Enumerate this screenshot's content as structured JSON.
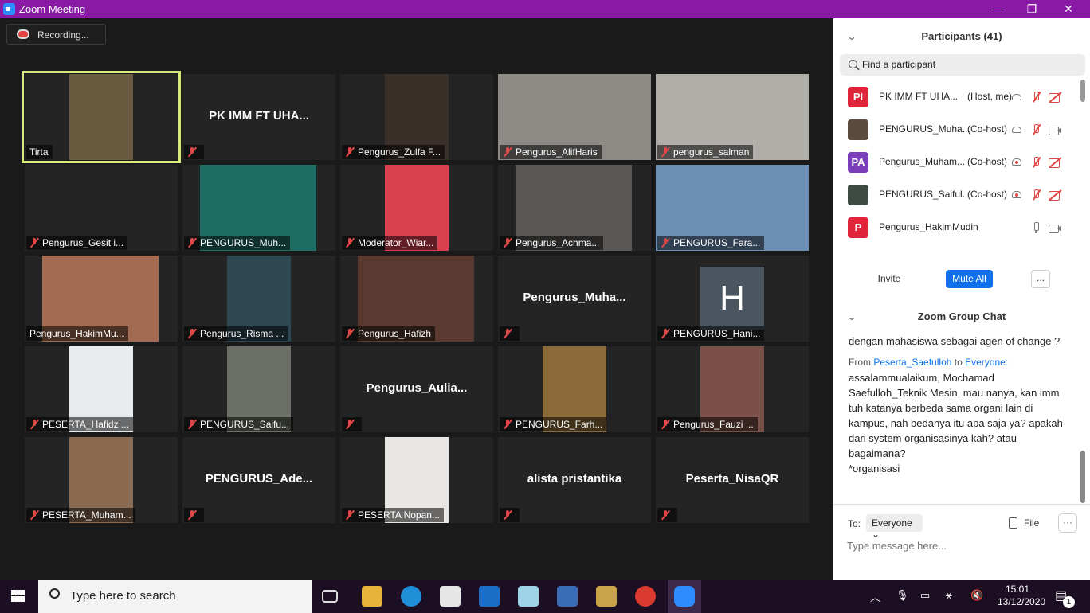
{
  "window": {
    "title": "Zoom Meeting",
    "minimize": "—",
    "restore": "❐",
    "close": "✕"
  },
  "recording": {
    "label": "Recording..."
  },
  "tiles": [
    {
      "label": "Tirta",
      "muted": false,
      "active": true,
      "video": "#6a5a40"
    },
    {
      "big": "PK IMM FT UHA...",
      "label": "",
      "muted": true
    },
    {
      "label": "Pengurus_Zulfa F...",
      "muted": true,
      "video": "#3b2f2a"
    },
    {
      "label": "Pengurus_AlifHaris",
      "muted": true,
      "video": "#8d8a86"
    },
    {
      "label": "pengurus_salman",
      "muted": true,
      "video": "#b0aea8"
    },
    {
      "label": "Pengurus_Gesit i...",
      "muted": true
    },
    {
      "label": "PENGURUS_Muh...",
      "muted": true,
      "video": "#1f6e64"
    },
    {
      "label": "Moderator_Wiar...",
      "muted": true,
      "video": "#d94050"
    },
    {
      "label": "Pengurus_Achma...",
      "muted": true,
      "video": "#5a5854"
    },
    {
      "label": "PENGURUS_Fara...",
      "muted": true,
      "video": "#6d8fb5"
    },
    {
      "label": "Pengurus_HakimMu...",
      "muted": false,
      "video": "#a36b52"
    },
    {
      "label": "Pengurus_Risma ...",
      "muted": true,
      "video": "#2d4850"
    },
    {
      "label": "Pengurus_Hafizh",
      "muted": true,
      "video": "#5a3a30"
    },
    {
      "big": "Pengurus_Muha...",
      "label": "",
      "muted": true
    },
    {
      "avatar": "H",
      "label": "PENGURUS_Hani...",
      "muted": true
    },
    {
      "label": "PESERTA_Hafidz ...",
      "muted": true,
      "video": "#e8ecee"
    },
    {
      "label": "PENGURUS_Saifu...",
      "muted": true,
      "video": "#6b6f66"
    },
    {
      "big": "Pengurus_Aulia...",
      "label": "",
      "muted": true
    },
    {
      "label": "PENGURUS_Farh...",
      "muted": true,
      "video": "#8a6a38"
    },
    {
      "label": "Pengurus_Fauzi ...",
      "muted": true,
      "video": "#7a5048"
    },
    {
      "label": "PESERTA_Muham...",
      "muted": true,
      "video": "#8a6a50"
    },
    {
      "big": "PENGURUS_Ade...",
      "label": "",
      "muted": true
    },
    {
      "label": "PESERTA Nopan...",
      "muted": true,
      "video": "#e9e7e3"
    },
    {
      "big": "alista pristantika",
      "label": "",
      "muted": true
    },
    {
      "big": "Peserta_NisaQR",
      "label": "",
      "muted": true
    }
  ],
  "participants": {
    "title": "Participants (41)",
    "search_placeholder": "Find a participant",
    "rows": [
      {
        "initials": "PI",
        "color": "#e0253a",
        "name": "PK IMM FT UHA...",
        "role": "(Host, me)",
        "icons": [
          "share",
          "mic-red",
          "cam-red"
        ]
      },
      {
        "initials": "",
        "color": "#5b4a3d",
        "name": "PENGURUS_Muha...",
        "role": "(Co-host)",
        "icons": [
          "share",
          "mic-red",
          "cam"
        ]
      },
      {
        "initials": "PA",
        "color": "#7a3fb8",
        "name": "Pengurus_Muham...",
        "role": "(Co-host)",
        "icons": [
          "rec",
          "mic-red",
          "cam-red"
        ]
      },
      {
        "initials": "",
        "color": "#3f4a44",
        "name": "PENGURUS_Saiful...",
        "role": "(Co-host)",
        "icons": [
          "rec",
          "mic-red",
          "cam-red"
        ]
      },
      {
        "initials": "P",
        "color": "#e0253a",
        "name": "Pengurus_HakimMudin",
        "role": "",
        "icons": [
          "mic",
          "cam"
        ]
      }
    ],
    "invite": "Invite",
    "mute_all": "Mute All",
    "more": "..."
  },
  "chat": {
    "title": "Zoom Group Chat",
    "prev_message": "dengan mahasiswa sebagai agen of change ?",
    "from_prefix": "From",
    "from_sender": "Peserta_Saefulloh",
    "from_to": "to",
    "from_recipient": "Everyone:",
    "message": "assalammualaikum, Mochamad Saefulloh_Teknik Mesin, mau nanya, kan imm tuh katanya berbeda sama organi lain di kampus, nah bedanya itu apa saja ya? apakah dari system organisasinya kah? atau bagaimana?",
    "message_note": "*organisasi",
    "to_label": "To:",
    "to_value": "Everyone",
    "file_label": "File",
    "more": "···",
    "input_placeholder": "Type message here..."
  },
  "taskbar": {
    "search_placeholder": "Type here to search",
    "time": "15:01",
    "date": "13/12/2020",
    "notifications": "1"
  }
}
